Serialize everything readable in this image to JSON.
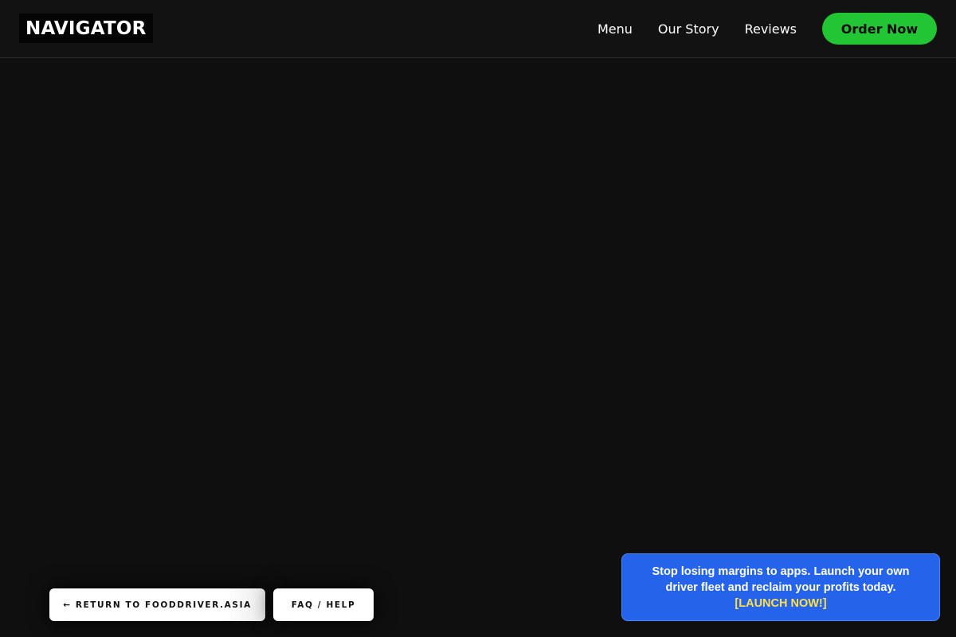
{
  "header": {
    "logo_text": "NAVIGATOR",
    "nav_items": [
      {
        "label": "Menu"
      },
      {
        "label": "Our Story"
      },
      {
        "label": "Reviews"
      }
    ],
    "cta_label": "Order Now"
  },
  "footer_buttons": {
    "return_label": "← RETURN TO FOODDRIVER.ASIA",
    "faq_label": "FAQ / HELP"
  },
  "promo": {
    "message": "Stop losing margins to apps. Launch your own driver fleet and reclaim your profits today.",
    "link_text": "[LAUNCH NOW!]"
  },
  "colors": {
    "background": "#0f0f0f",
    "header_bg": "#121212",
    "cta_green": "#22c534",
    "promo_blue": "#2563eb",
    "promo_link_yellow": "#fde047"
  }
}
